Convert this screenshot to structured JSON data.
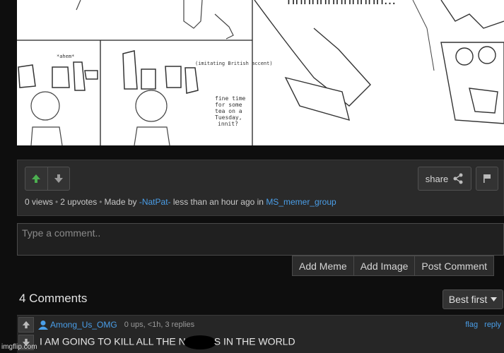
{
  "comic": {
    "sfx_text": "hhhhhhhhhhhh...",
    "panel_left_note": "*ahem*",
    "panel_mid_note": "(imitating British accent)",
    "speech": [
      "fine time",
      "for some",
      "tea on a",
      "Tuesday,",
      "innit?"
    ]
  },
  "post": {
    "share_label": "share",
    "views": "0 views",
    "upvotes": "2 upvotes",
    "made_by_prefix": "Made by",
    "author": "-NatPat-",
    "time": "less than an hour ago in",
    "stream": "MS_memer_group"
  },
  "comment_box": {
    "placeholder": "Type a comment..",
    "buttons": [
      "Add Meme",
      "Add Image",
      "Post Comment"
    ]
  },
  "comments": {
    "title": "4 Comments",
    "sort": "Best first",
    "items": [
      {
        "user": "Among_Us_OMG",
        "info": "0 ups, <1h, 3 replies",
        "flag": "flag",
        "reply": "reply",
        "text_before": "I AM GOING TO KILL ALL THE N",
        "text_after": "S IN THE WORLD"
      }
    ]
  },
  "watermark": "imgflip.com",
  "colors": {
    "accent_green": "#4caf50",
    "link_blue": "#4a9ee8"
  }
}
